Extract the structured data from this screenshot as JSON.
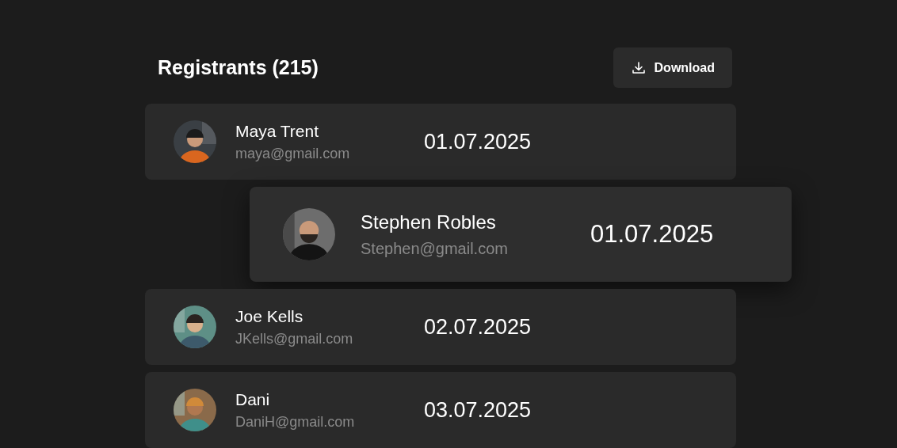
{
  "header": {
    "title": "Registrants (215)",
    "download_button": "Download"
  },
  "rows": [
    {
      "name": "Maya Trent",
      "email": "maya@gmail.com",
      "date": "01.07.2025"
    },
    {
      "name": "Joe Kells",
      "email": "JKells@gmail.com",
      "date": "02.07.2025"
    },
    {
      "name": "Dani",
      "email": "DaniH@gmail.com",
      "date": "03.07.2025"
    }
  ],
  "dragged_row": {
    "name": "Stephen Robles",
    "email": "Stephen@gmail.com",
    "date": "01.07.2025"
  }
}
